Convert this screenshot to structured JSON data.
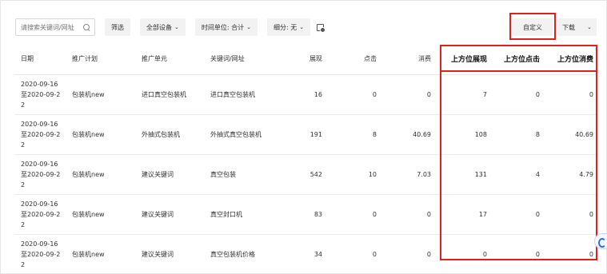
{
  "toolbar": {
    "search_placeholder": "请搜索关键词/网址",
    "filter_label": "筛选",
    "device_label": "全部设备",
    "time_unit_label": "时间单位: 合计",
    "breakdown_label": "细分: 无",
    "custom_label": "自定义",
    "download_label": "下载"
  },
  "table": {
    "columns": [
      "日期",
      "推广计划",
      "推广单元",
      "关键词/网址",
      "展现",
      "点击",
      "消费",
      "上方位展现",
      "上方位点击",
      "上方位消费"
    ],
    "rows": [
      {
        "date_line1": "2020-09-16",
        "date_line2": "至2020-09-2",
        "date_line3": "2",
        "plan": "包装机new",
        "unit": "进口真空包装机",
        "keyword": "进口真空包装机",
        "impressions": "16",
        "clicks": "0",
        "cost": "0",
        "top_impr": "7",
        "top_clicks": "0",
        "top_cost": "0"
      },
      {
        "date_line1": "2020-09-16",
        "date_line2": "至2020-09-2",
        "date_line3": "2",
        "plan": "包装机new",
        "unit": "外抽式包装机",
        "keyword": "外抽式真空包装机",
        "impressions": "191",
        "clicks": "8",
        "cost": "40.69",
        "top_impr": "108",
        "top_clicks": "8",
        "top_cost": "40.69"
      },
      {
        "date_line1": "2020-09-16",
        "date_line2": "至2020-09-2",
        "date_line3": "2",
        "plan": "包装机new",
        "unit": "建议关键词",
        "keyword": "真空包装",
        "impressions": "542",
        "clicks": "10",
        "cost": "7.03",
        "top_impr": "131",
        "top_clicks": "4",
        "top_cost": "4.79"
      },
      {
        "date_line1": "2020-09-16",
        "date_line2": "至2020-09-2",
        "date_line3": "2",
        "plan": "包装机new",
        "unit": "建议关键词",
        "keyword": "真空封口机",
        "impressions": "83",
        "clicks": "0",
        "cost": "0",
        "top_impr": "17",
        "top_clicks": "0",
        "top_cost": "0"
      },
      {
        "date_line1": "2020-09-16",
        "date_line2": "至2020-09-2",
        "date_line3": "2",
        "plan": "包装机new",
        "unit": "建议关键词",
        "keyword": "真空包装机价格",
        "impressions": "34",
        "clicks": "0",
        "cost": "0",
        "top_impr": "0",
        "top_clicks": "0",
        "top_cost": "0"
      }
    ]
  },
  "colors": {
    "highlight": "#e02020",
    "chip_bg": "#f2f2f2"
  }
}
